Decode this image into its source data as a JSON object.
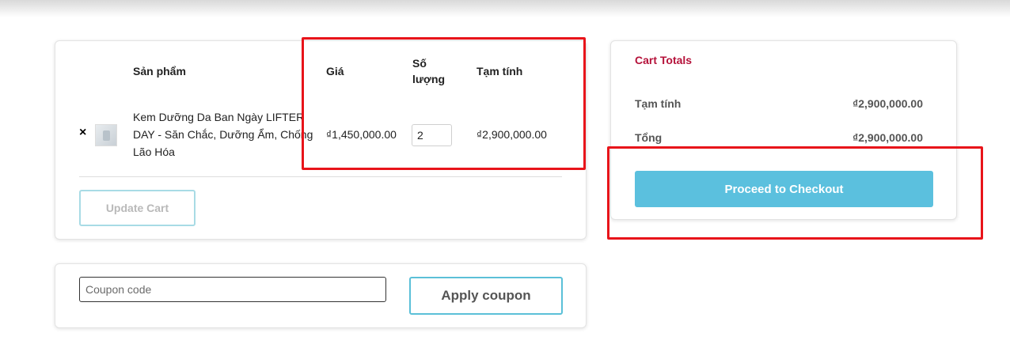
{
  "cart": {
    "headers": {
      "product": "Sản phẩm",
      "price": "Giá",
      "quantity_line1": "Số",
      "quantity_line2": "lượng",
      "subtotal": "Tạm tính"
    },
    "items": [
      {
        "remove": "×",
        "name": "Kem Dưỡng Da Ban Ngày LIFTER DAY - Săn Chắc, Dưỡng Ẩm, Chống Lão Hóa",
        "price": "₫1,450,000.00",
        "quantity": "2",
        "subtotal": "₫2,900,000.00"
      }
    ],
    "update_label": "Update Cart"
  },
  "coupon": {
    "placeholder": "Coupon code",
    "apply_label": "Apply coupon"
  },
  "totals": {
    "title": "Cart Totals",
    "subtotal_label": "Tạm tính",
    "subtotal_value": "₫2,900,000.00",
    "total_label": "Tổng",
    "total_value": "₫2,900,000.00",
    "checkout_label": "Proceed to Checkout"
  },
  "colors": {
    "accent": "#5bc0de",
    "title": "#b5123a",
    "highlight": "#e8141a"
  }
}
